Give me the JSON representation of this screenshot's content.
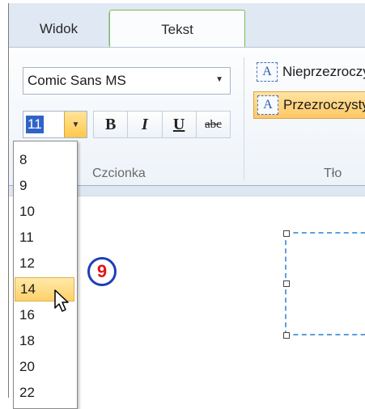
{
  "tabs": {
    "widok": "Widok",
    "tekst": "Tekst"
  },
  "font": {
    "family": "Comic Sans MS",
    "size": "11"
  },
  "format_buttons": {
    "bold": "B",
    "italic": "I",
    "underline": "U",
    "strikethrough": "abc"
  },
  "groups": {
    "font_label": "Czcionka",
    "background_label": "Tło"
  },
  "background_options": [
    {
      "label": "Nieprzezroczysty",
      "icon": "A-box-icon",
      "selected": false
    },
    {
      "label": "Przezroczysty",
      "icon": "A-box-icon",
      "selected": true
    }
  ],
  "size_dropdown": {
    "items": [
      "8",
      "9",
      "10",
      "11",
      "12",
      "14",
      "16",
      "18",
      "20",
      "22"
    ],
    "highlighted": "14"
  },
  "step_badge": "9",
  "colors": {
    "accent_green": "#7bbf4b",
    "highlight": "#ffd16a",
    "badge_ring": "#1e3fb8",
    "badge_text": "#e31414"
  }
}
